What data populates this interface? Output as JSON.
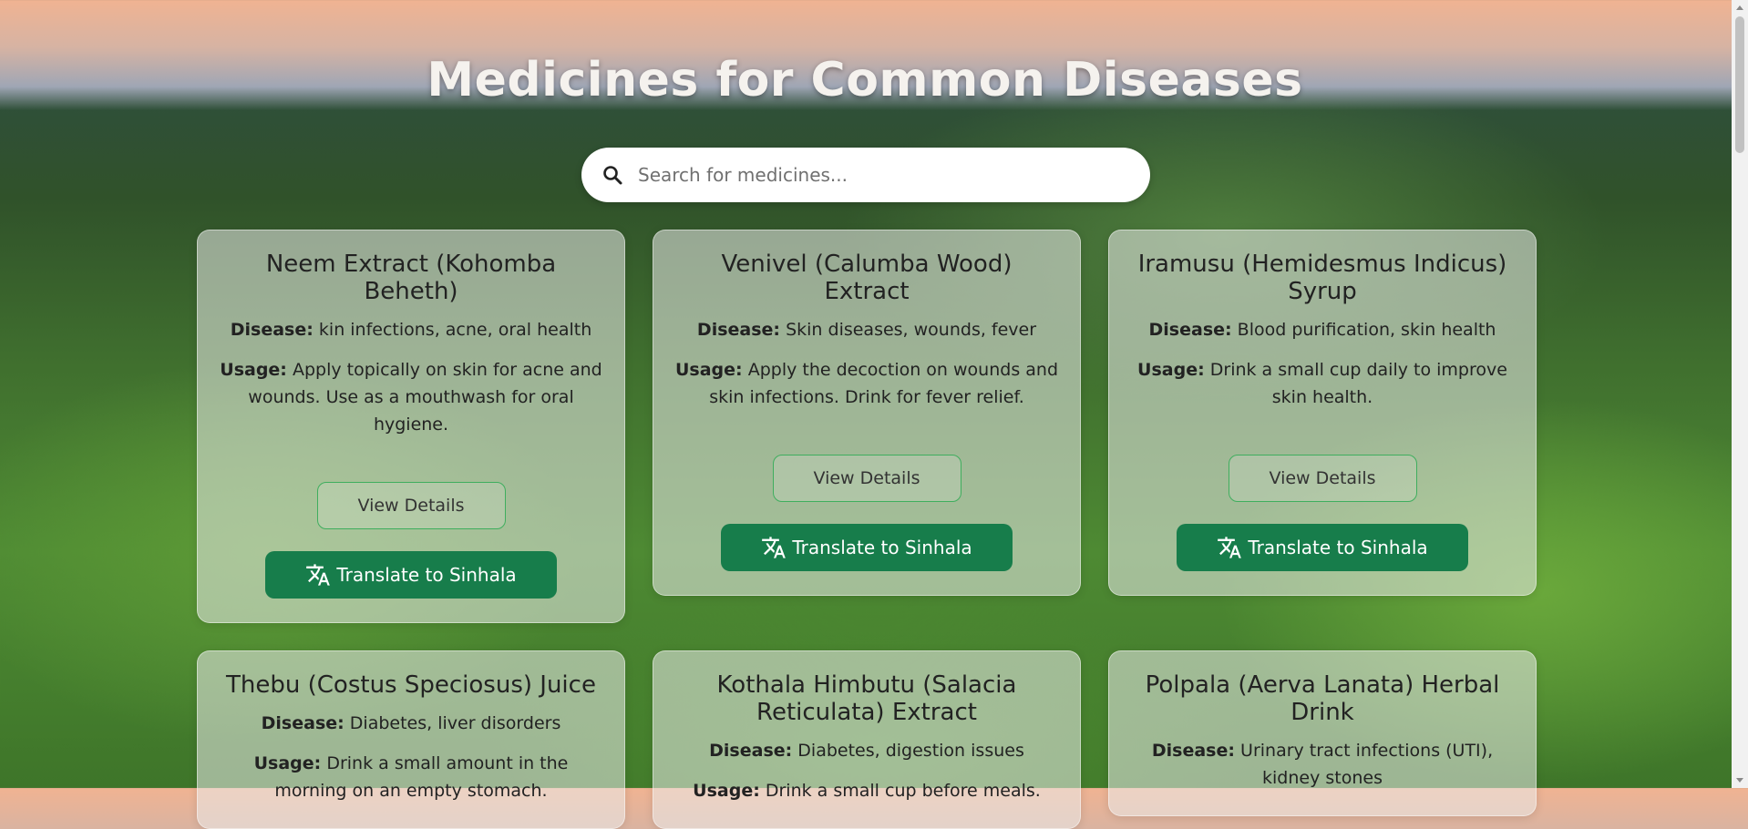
{
  "header": {
    "title": "Medicines for Common Diseases"
  },
  "search": {
    "placeholder": "Search for medicines...",
    "icon": "search-icon"
  },
  "labels": {
    "disease": "Disease:",
    "usage": "Usage:"
  },
  "cards": [
    {
      "name": "Neem Extract (Kohomba Beheth)",
      "disease": "kin infections, acne, oral health",
      "usage": "Apply topically on skin for acne and wounds. Use as a mouthwash for oral hygiene.",
      "details_label": "View Details",
      "translate_label": "Translate to Sinhala"
    },
    {
      "name": "Venivel (Calumba Wood) Extract",
      "disease": "Skin diseases, wounds, fever",
      "usage": "Apply the decoction on wounds and skin infections. Drink for fever relief.",
      "details_label": "View Details",
      "translate_label": "Translate to Sinhala"
    },
    {
      "name": "Iramusu (Hemidesmus Indicus) Syrup",
      "disease": "Blood purification, skin health",
      "usage": "Drink a small cup daily to improve skin health.",
      "details_label": "View Details",
      "translate_label": "Translate to Sinhala"
    },
    {
      "name": "Thebu (Costus Speciosus) Juice",
      "disease": "Diabetes, liver disorders",
      "usage": "Drink a small amount in the morning on an empty stomach."
    },
    {
      "name": "Kothala Himbutu (Salacia Reticulata) Extract",
      "disease": "Diabetes, digestion issues",
      "usage": "Drink a small cup before meals."
    },
    {
      "name": "Polpala (Aerva Lanata) Herbal Drink",
      "disease": "Urinary tract infections (UTI), kidney stones"
    }
  ]
}
